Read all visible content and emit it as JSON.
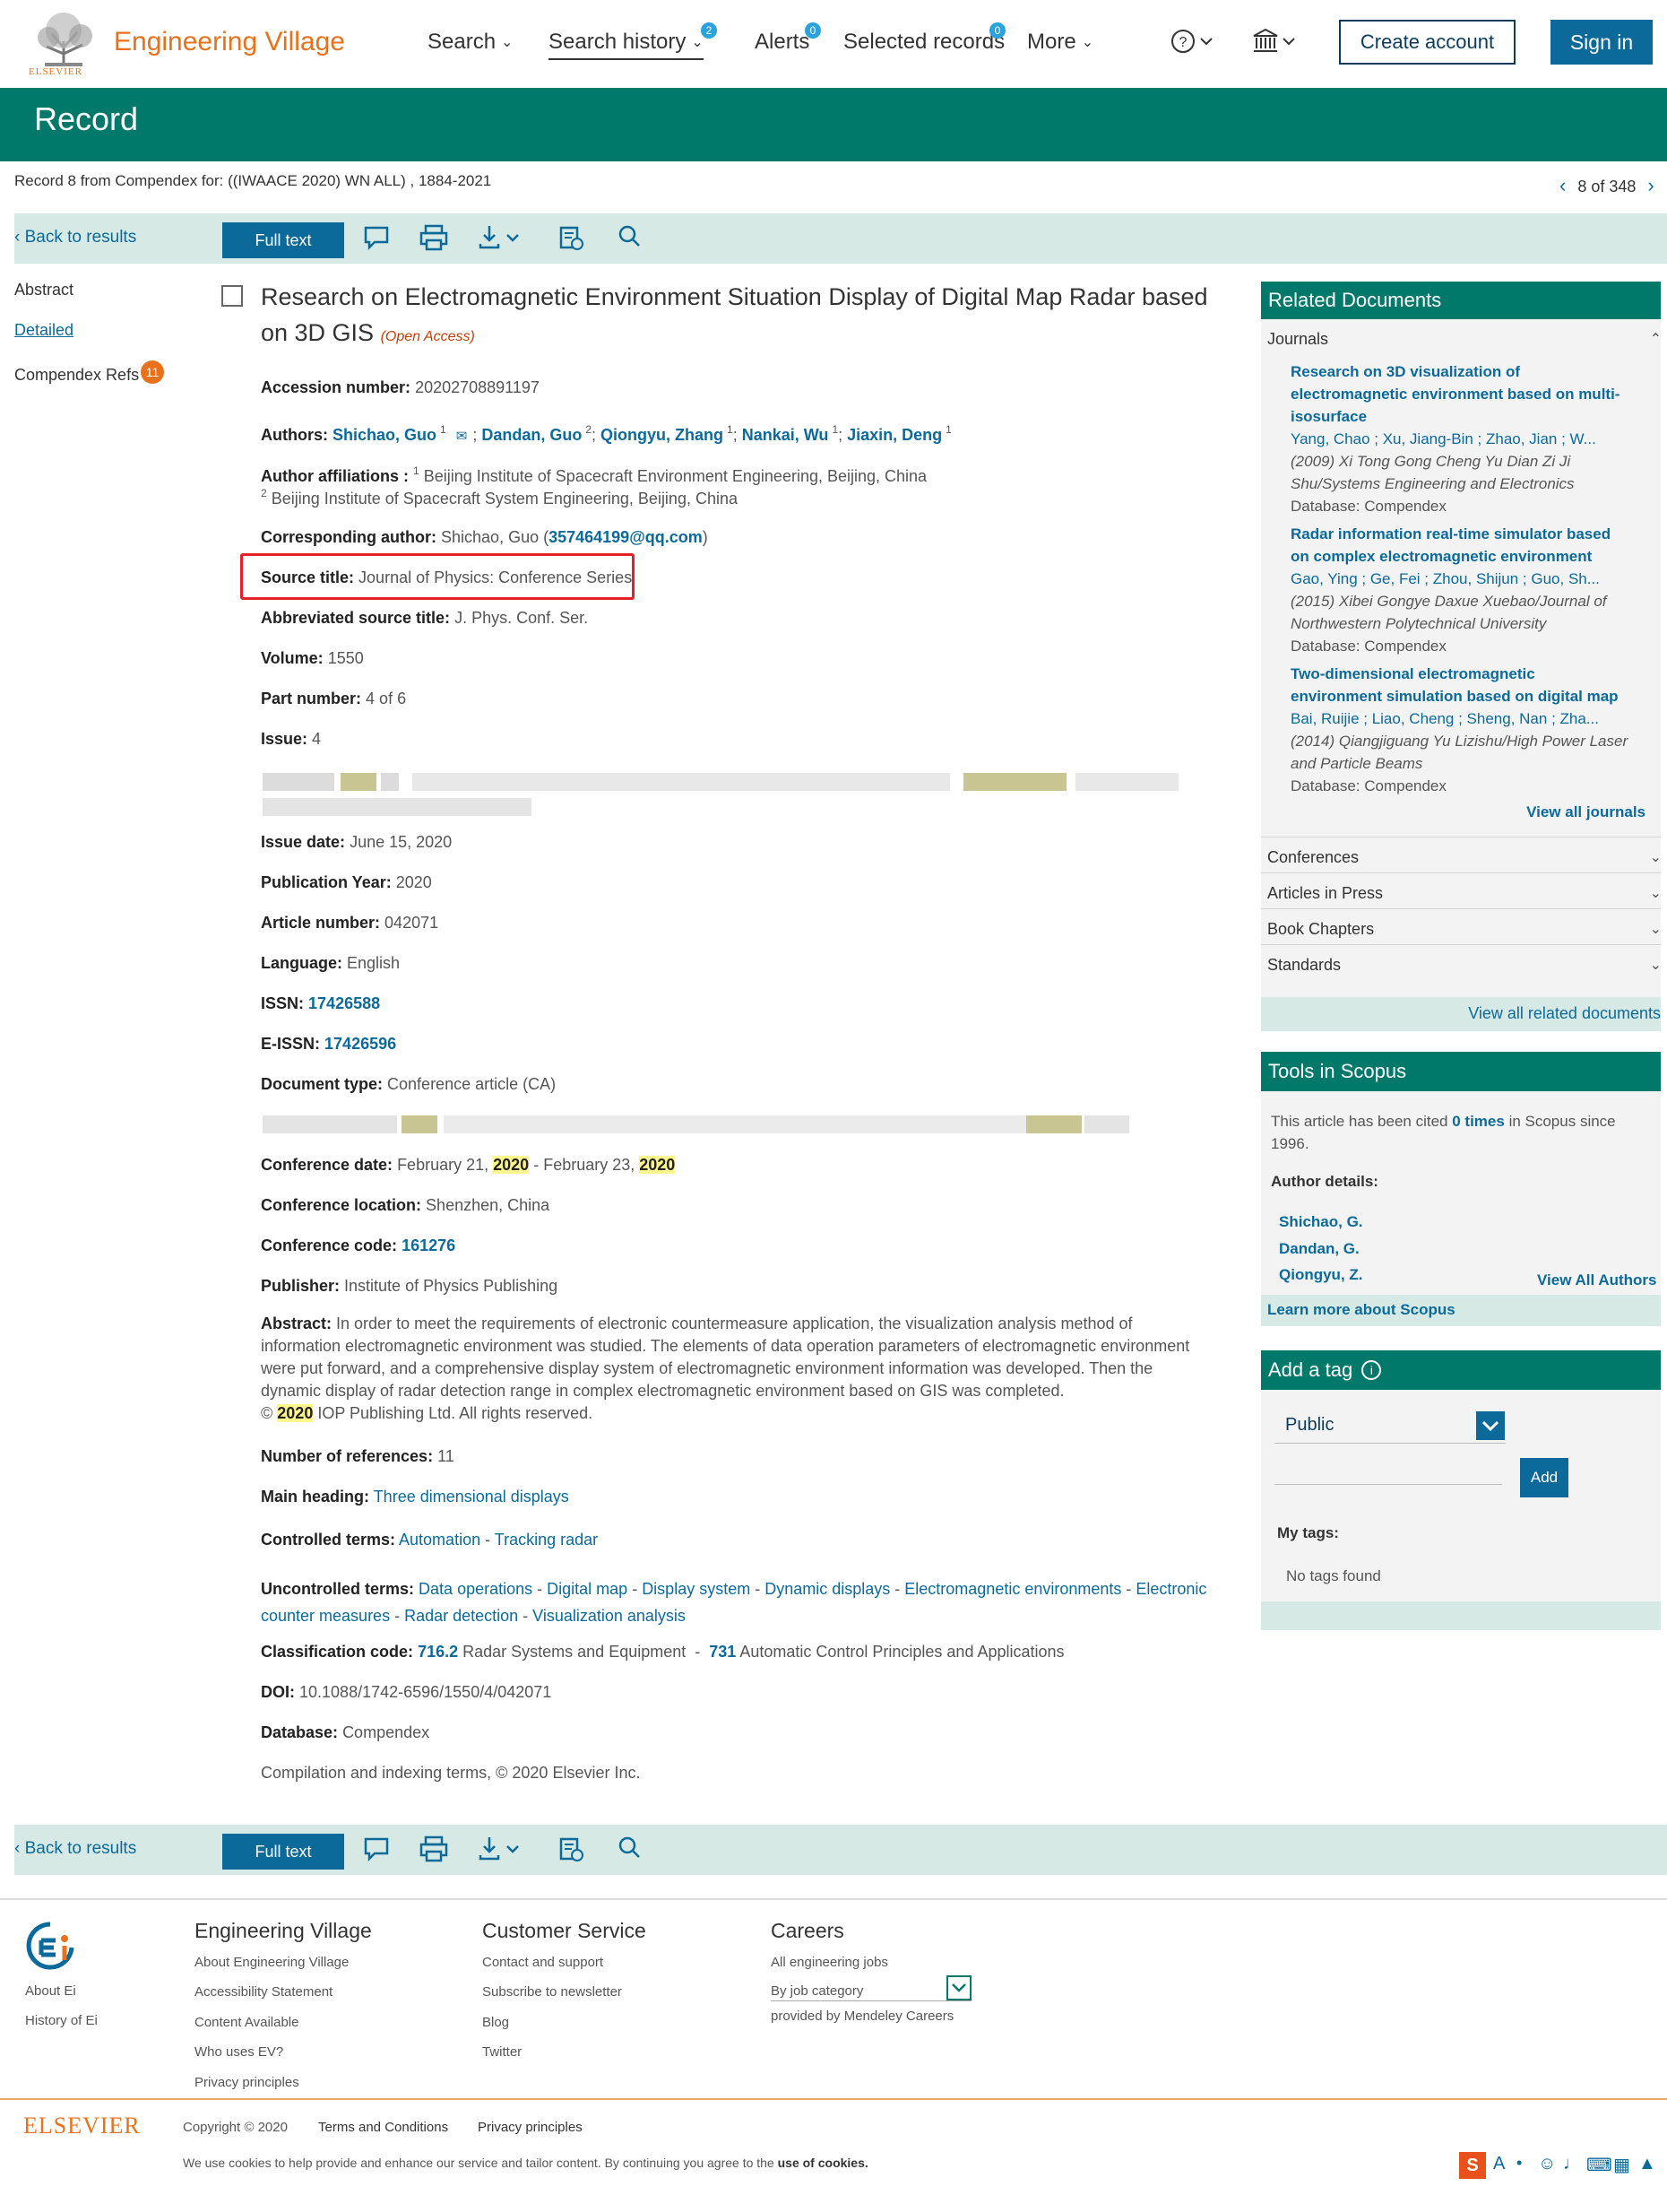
{
  "header": {
    "logo_text": "Engineering Village",
    "logo_sub": "ELSEVIER",
    "nav": {
      "search": "Search",
      "search_history": "Search history",
      "search_history_count": "2",
      "alerts": "Alerts",
      "alerts_count": "0",
      "selected_records": "Selected records",
      "selected_count": "0",
      "more": "More"
    },
    "create_account": "Create account",
    "sign_in": "Sign in"
  },
  "record_bar": {
    "title": "Record"
  },
  "record_info": {
    "from": "Record 8 from Compendex for: ((IWAACE 2020) WN ALL) , 1884-2021",
    "pager": "8 of 348"
  },
  "toolbar": {
    "back": "Back to results",
    "full_text": "Full text"
  },
  "left_nav": {
    "abstract": "Abstract",
    "detailed": "Detailed",
    "refs": "Compendex Refs",
    "refs_count": "11"
  },
  "document": {
    "title": "Research on Electromagnetic Environment Situation Display of Digital Map Radar based on 3D GIS",
    "open_access": "(Open Access)",
    "accession_label": "Accession number:",
    "accession": "20202708891197",
    "authors_label": "Authors:",
    "authors": [
      "Shichao, Guo",
      "Dandan, Guo",
      "Qiongyu, Zhang",
      "Nankai, Wu",
      "Jiaxin, Deng"
    ],
    "author_sups": [
      "1",
      "2",
      "1",
      "1",
      "1"
    ],
    "affiliations_label": "Author affiliations :",
    "affiliation_1": "Beijing Institute of Spacecraft Environment Engineering, Beijing, China",
    "affiliation_2": "Beijing Institute of Spacecraft System Engineering, Beijing, China",
    "corresponding_label": "Corresponding author:",
    "corresponding_name": "Shichao, Guo",
    "corresponding_email": "357464199@qq.com",
    "source_label": "Source title:",
    "source": "Journal of Physics: Conference Series",
    "abbrev_label": "Abbreviated source title:",
    "abbrev": "J. Phys. Conf. Ser.",
    "volume_label": "Volume:",
    "volume": "1550",
    "part_label": "Part number:",
    "part": "4 of 6",
    "issue_label": "Issue:",
    "issue": "4",
    "issue_date_label": "Issue date:",
    "issue_date": "June 15, 2020",
    "pub_year_label": "Publication Year:",
    "pub_year": "2020",
    "article_label": "Article number:",
    "article": "042071",
    "language_label": "Language:",
    "language": "English",
    "issn_label": "ISSN:",
    "issn": "17426588",
    "eissn_label": "E-ISSN:",
    "eissn": "17426596",
    "doctype_label": "Document type:",
    "doctype": "Conference article (CA)",
    "conf_date_label": "Conference date:",
    "conf_date_1": "February 21,",
    "conf_year_1": "2020",
    "conf_date_2": "- February 23,",
    "conf_year_2": "2020",
    "conf_loc_label": "Conference location:",
    "conf_loc": "Shenzhen, China",
    "conf_code_label": "Conference code:",
    "conf_code": "161276",
    "publisher_label": "Publisher:",
    "publisher": "Institute of Physics Publishing",
    "abstract_label": "Abstract:",
    "abstract_text": "In order to meet the requirements of electronic countermeasure application, the visualization analysis method of information electromagnetic environment was studied. The elements of data operation parameters of electromagnetic environment were put forward, and a comprehensive display system of electromagnetic environment information was developed. Then the dynamic display of radar detection range in complex electromagnetic environment based on GIS was completed.",
    "abstract_copyright_pre": "©",
    "abstract_year": "2020",
    "abstract_copyright_post": "IOP Publishing Ltd. All rights reserved.",
    "num_refs_label": "Number of references:",
    "num_refs": "11",
    "main_heading_label": "Main heading:",
    "main_heading": "Three dimensional displays",
    "controlled_label": "Controlled terms:",
    "controlled": [
      "Automation",
      "Tracking radar"
    ],
    "uncontrolled_label": "Uncontrolled terms:",
    "uncontrolled": [
      "Data operations",
      "Digital map",
      "Display system",
      "Dynamic displays",
      "Electromagnetic environments",
      "Electronic counter measures",
      "Radar detection",
      "Visualization analysis"
    ],
    "class_label": "Classification code:",
    "class_1_code": "716.2",
    "class_1_text": "Radar Systems and Equipment",
    "class_2_code": "731",
    "class_2_text": "Automatic Control Principles and Applications",
    "doi_label": "DOI:",
    "doi": "10.1088/1742-6596/1550/4/042071",
    "database_label": "Database:",
    "database": "Compendex",
    "compilation": "Compilation and indexing terms, © 2020 Elsevier Inc."
  },
  "related": {
    "header": "Related Documents",
    "journals_label": "Journals",
    "items": [
      {
        "title_1": "Research on 3D visualization of",
        "title_2": "electromagnetic environment based on multi-",
        "title_3": "isosurface",
        "authors": "Yang, Chao ; Xu, Jiang-Bin ; Zhao, Jian ; W...",
        "source_1": "(2009) Xi Tong Gong Cheng Yu Dian Zi Ji",
        "source_2": "Shu/Systems Engineering and Electronics",
        "db": "Database: Compendex"
      },
      {
        "title_1": "Radar information real-time simulator based",
        "title_2": "on complex electromagnetic environment",
        "authors": "Gao, Ying ; Ge, Fei ; Zhou, Shijun ; Guo, Sh...",
        "source_1": "(2015) Xibei Gongye Daxue Xuebao/Journal of",
        "source_2": "Northwestern Polytechnical University",
        "db": "Database: Compendex"
      },
      {
        "title_1": "Two-dimensional electromagnetic",
        "title_2": "environment simulation based on digital map",
        "authors": "Bai, Ruijie ; Liao, Cheng ; Sheng, Nan ; Zha...",
        "source_1": "(2014) Qiangjiguang Yu Lizishu/High Power Laser",
        "source_2": "and Particle Beams",
        "db": "Database: Compendex"
      }
    ],
    "view_all_journals": "View all journals",
    "conferences": "Conferences",
    "articles_in_press": "Articles in Press",
    "book_chapters": "Book Chapters",
    "standards": "Standards",
    "view_all_related": "View all related documents"
  },
  "scopus": {
    "header": "Tools in Scopus",
    "cited_pre": "This article has been cited",
    "cited_times": "0 times",
    "cited_post": "in Scopus since",
    "cited_since": "1996.",
    "author_details": "Author details:",
    "authors": [
      "Shichao, G.",
      "Dandan, G.",
      "Qiongyu, Z."
    ],
    "view_all_authors": "View All Authors",
    "learn_more": "Learn more about Scopus"
  },
  "tag": {
    "header": "Add a tag",
    "visibility": "Public",
    "add": "Add",
    "my_tags": "My tags:",
    "none": "No tags found"
  },
  "footer": {
    "about_ei": "About Ei",
    "history_ei": "History of Ei",
    "col1_head": "Engineering Village",
    "col1": [
      "About Engineering Village",
      "Accessibility Statement",
      "Content Available",
      "Who uses EV?",
      "Privacy principles"
    ],
    "col2_head": "Customer Service",
    "col2": [
      "Contact and support",
      "Subscribe to newsletter",
      "Blog",
      "Twitter"
    ],
    "col3_head": "Careers",
    "col3_jobs": "All engineering jobs",
    "col3_category": "By job category",
    "col3_provided": "provided by Mendeley Careers",
    "elsevier": "ELSEVIER",
    "copyright": "Copyright © 2020",
    "terms": "Terms and Conditions",
    "privacy": "Privacy principles",
    "cookies_pre": "We use cookies to help provide and enhance our service and tailor content. By continuing you agree to the",
    "cookies_link": "use of cookies."
  }
}
